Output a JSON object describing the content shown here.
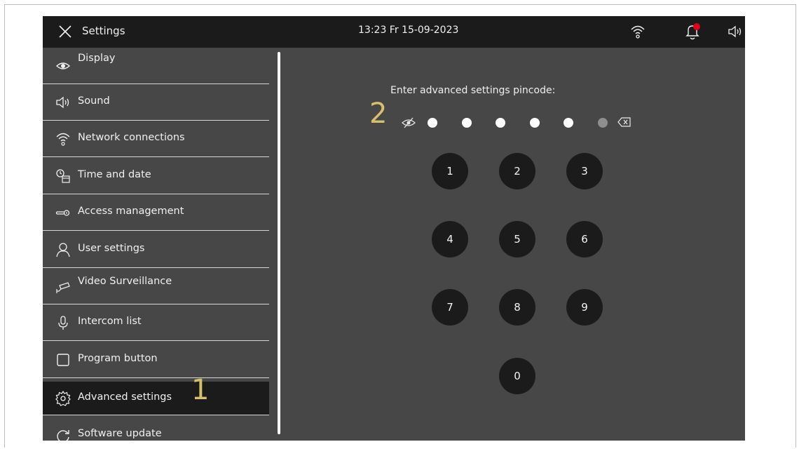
{
  "header": {
    "title": "Settings",
    "datetime": "13:23  Fr 15-09-2023",
    "icons": [
      "close-icon",
      "wifi-icon",
      "bell-icon",
      "speaker-icon"
    ],
    "notification_color": "#e2001a"
  },
  "sidebar": {
    "items": [
      {
        "label": "Display",
        "icon": "eye-icon"
      },
      {
        "label": "Sound",
        "icon": "speaker-icon"
      },
      {
        "label": "Network connections",
        "icon": "wifi-icon"
      },
      {
        "label": "Time and date",
        "icon": "clock-calendar-icon"
      },
      {
        "label": "Access  management",
        "icon": "key-icon"
      },
      {
        "label": "User settings",
        "icon": "user-icon"
      },
      {
        "label": "Video Surveillance",
        "icon": "camera-icon"
      },
      {
        "label": "Intercom list",
        "icon": "microphone-icon"
      },
      {
        "label": "Program button",
        "icon": "square-icon"
      },
      {
        "label": "Advanced settings",
        "icon": "gear-icon",
        "active": true
      },
      {
        "label": "Software update",
        "icon": "refresh-icon"
      }
    ]
  },
  "markers": {
    "one": "1",
    "two": "2"
  },
  "pin": {
    "prompt": "Enter advanced settings pincode:",
    "entered": 5,
    "length": 6,
    "icons": [
      "hide-icon",
      "backspace-icon"
    ]
  },
  "keypad": {
    "keys": [
      "1",
      "2",
      "3",
      "4",
      "5",
      "6",
      "7",
      "8",
      "9",
      "0"
    ]
  },
  "colors": {
    "screen_bg": "#474747",
    "bar_bg": "#1b1b1b",
    "marker": "#d8c06a"
  }
}
